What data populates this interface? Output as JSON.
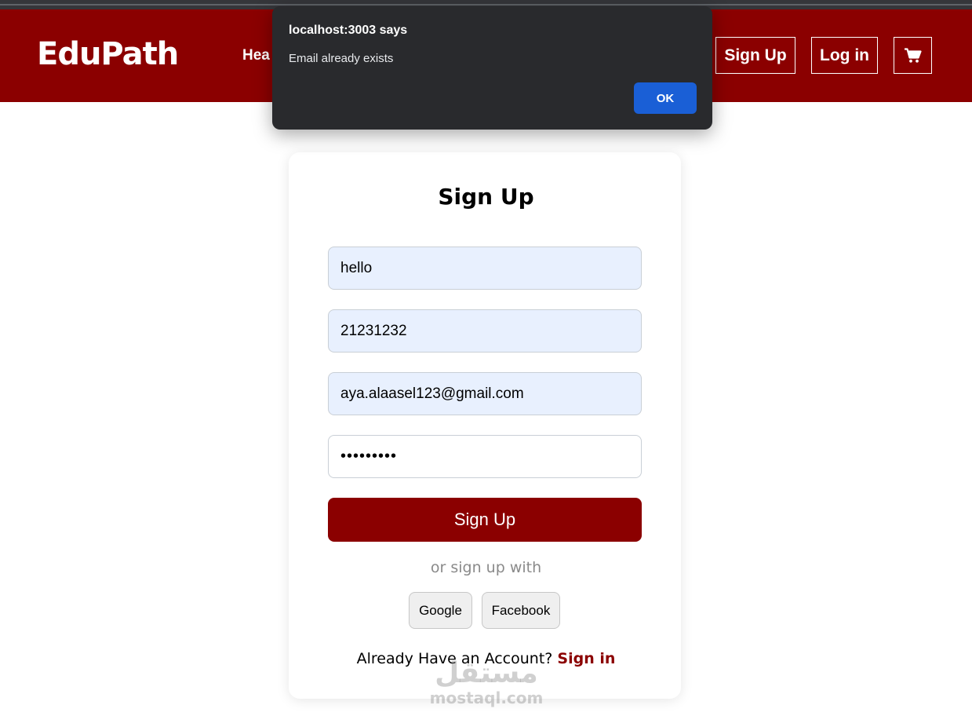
{
  "navbar": {
    "brand": "EduPath",
    "partial_link": "Hea",
    "signup_label": "Sign Up",
    "login_label": "Log in",
    "cart_icon": "cart-icon",
    "color": "#8b0000"
  },
  "alert": {
    "title": "localhost:3003 says",
    "message": "Email already exists",
    "ok_label": "OK",
    "ok_color": "#1a5fd6"
  },
  "form": {
    "title": "Sign Up",
    "name_value": "hello",
    "phone_value": "21231232",
    "email_value": "aya.alaasel123@gmail.com",
    "password_masked": "•••••••••",
    "submit_label": "Sign Up",
    "or_text": "or sign up with",
    "google_label": "Google",
    "facebook_label": "Facebook",
    "already_text": "Already Have an Account?",
    "signin_label": "Sign in"
  },
  "watermark": {
    "arabic": "مستقل",
    "latin": "mostaql.com"
  }
}
